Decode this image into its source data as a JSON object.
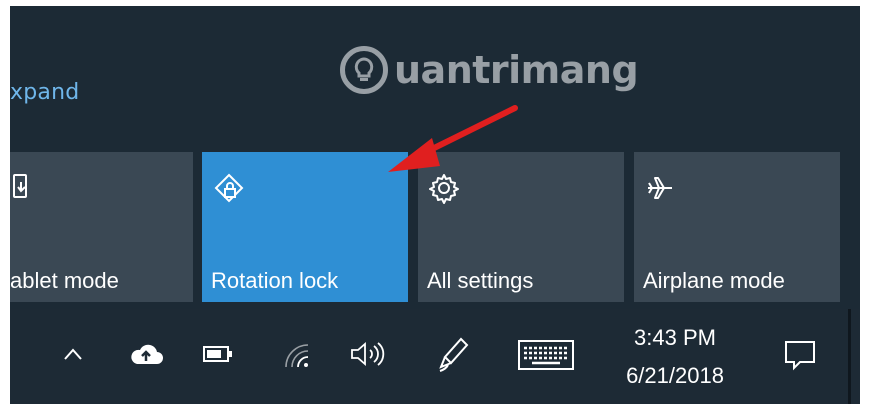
{
  "action_center": {
    "expand_link": "xpand",
    "watermark": "uantrimang",
    "tiles": [
      {
        "label": "ablet mode",
        "icon": "tablet-mode-icon",
        "active": false
      },
      {
        "label": "Rotation lock",
        "icon": "rotation-lock-icon",
        "active": true
      },
      {
        "label": "All settings",
        "icon": "gear-icon",
        "active": false
      },
      {
        "label": "Airplane mode",
        "icon": "airplane-icon",
        "active": false
      }
    ],
    "colors": {
      "background": "#1c2a35",
      "tile": "#3a4854",
      "active_tile": "#2f8fd4",
      "link": "#6fb6ea",
      "arrow": "#e01f1f"
    }
  },
  "taskbar": {
    "icons": [
      "chevron-up-icon",
      "onedrive-cloud-icon",
      "battery-icon",
      "wifi-icon",
      "volume-icon",
      "pen-ink-icon",
      "keyboard-icon",
      "action-center-icon"
    ],
    "time": "3:43 PM",
    "date": "6/21/2018"
  }
}
